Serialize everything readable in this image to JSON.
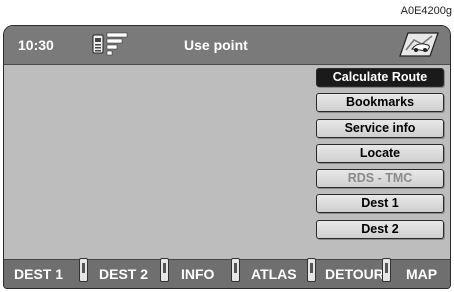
{
  "figure_id": "A0E4200g",
  "header": {
    "time": "10:30",
    "title": "Use point"
  },
  "menu": [
    {
      "label": "Calculate Route",
      "state": "selected"
    },
    {
      "label": "Bookmarks",
      "state": "normal"
    },
    {
      "label": "Service info",
      "state": "normal"
    },
    {
      "label": "Locate",
      "state": "normal"
    },
    {
      "label": "RDS - TMC",
      "state": "disabled"
    },
    {
      "label": "Dest 1",
      "state": "normal"
    },
    {
      "label": "Dest 2",
      "state": "normal"
    }
  ],
  "softkeys": [
    {
      "label": "DEST 1"
    },
    {
      "label": "DEST 2"
    },
    {
      "label": "INFO"
    },
    {
      "label": "ATLAS",
      "active": true
    },
    {
      "label": "DETOUR"
    },
    {
      "label": "MAP"
    }
  ],
  "icons": {
    "signal": "phone-signal-icon",
    "map": "map-car-icon"
  },
  "colors": {
    "screen_bg": "#bdbdbd",
    "bar_bg": "#7a7a7a",
    "selected_bg": "#1a1a1a"
  }
}
